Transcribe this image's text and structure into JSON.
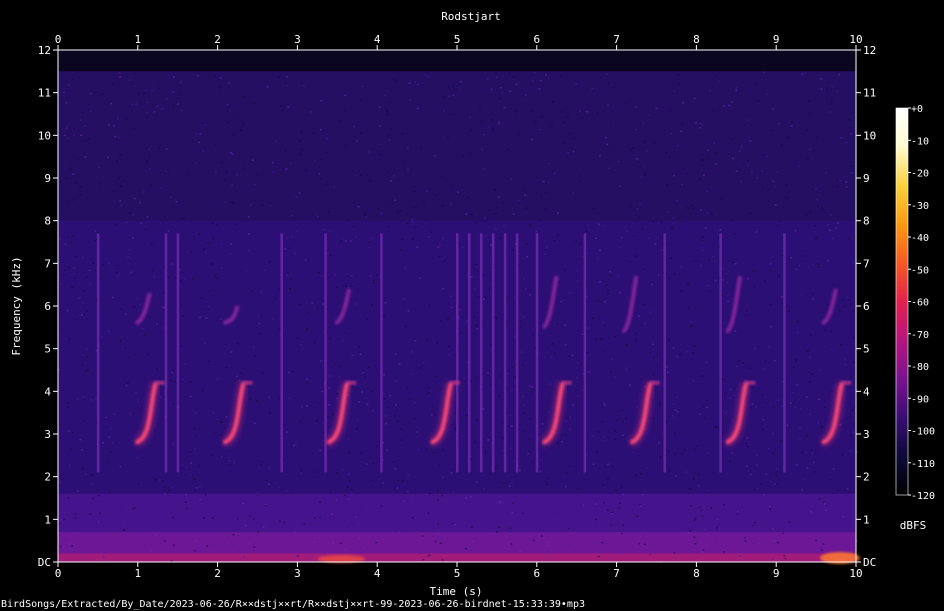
{
  "chart_data": {
    "type": "heatmap",
    "title": "Rodstjart",
    "xlabel": "Time (s)",
    "ylabel": "Frequency (kHz)",
    "xlim": [
      0,
      10
    ],
    "ylim": [
      0,
      12
    ],
    "x_ticks": [
      "0",
      "1",
      "2",
      "3",
      "4",
      "5",
      "6",
      "7",
      "8",
      "9",
      "10"
    ],
    "y_ticks": [
      "DC",
      "1",
      "2",
      "3",
      "4",
      "5",
      "6",
      "7",
      "8",
      "9",
      "10",
      "11",
      "12"
    ],
    "colorbar": {
      "label": "dBFS",
      "range": [
        -120,
        0
      ],
      "ticks": [
        "+0",
        "-10",
        "-20",
        "-30",
        "-40",
        "-50",
        "-60",
        "-70",
        "-80",
        "-90",
        "-100",
        "-110",
        "-120"
      ],
      "colors": [
        "#000000",
        "#0c0a38",
        "#3a0d73",
        "#7a128f",
        "#b7157f",
        "#e2224e",
        "#f65a22",
        "#fb9a12",
        "#f9d23c",
        "#fffbd0",
        "#ffffff"
      ]
    },
    "calls": [
      {
        "t": 1.15,
        "f_low": 2.8,
        "f_high": 4.2
      },
      {
        "t": 2.25,
        "f_low": 2.8,
        "f_high": 4.2
      },
      {
        "t": 3.55,
        "f_low": 2.8,
        "f_high": 4.2
      },
      {
        "t": 4.85,
        "f_low": 2.8,
        "f_high": 4.2
      },
      {
        "t": 6.25,
        "f_low": 2.8,
        "f_high": 4.2
      },
      {
        "t": 7.35,
        "f_low": 2.8,
        "f_high": 4.2
      },
      {
        "t": 8.55,
        "f_low": 2.8,
        "f_high": 4.2
      },
      {
        "t": 9.75,
        "f_low": 2.8,
        "f_high": 4.2
      }
    ],
    "upper_calls": [
      {
        "t": 1.1,
        "f_low": 5.6,
        "f_high": 6.3
      },
      {
        "t": 2.2,
        "f_low": 5.6,
        "f_high": 6.0
      },
      {
        "t": 3.6,
        "f_low": 5.6,
        "f_high": 6.4
      },
      {
        "t": 6.2,
        "f_low": 5.5,
        "f_high": 6.7
      },
      {
        "t": 7.2,
        "f_low": 5.4,
        "f_high": 6.7
      },
      {
        "t": 8.5,
        "f_low": 5.4,
        "f_high": 6.7
      },
      {
        "t": 9.7,
        "f_low": 5.6,
        "f_high": 6.4
      }
    ],
    "clicks": [
      0.5,
      1.35,
      1.5,
      2.8,
      3.35,
      4.05,
      5.0,
      5.15,
      5.3,
      5.45,
      5.6,
      5.75,
      6.0,
      6.6,
      7.6,
      8.3,
      9.1
    ]
  },
  "footer": "BirdSongs/Extracted/By_Date/2023-06-26/R××dstj××rt/R××dstj××rt-99-2023-06-26-birdnet-15:33:39•mp3"
}
